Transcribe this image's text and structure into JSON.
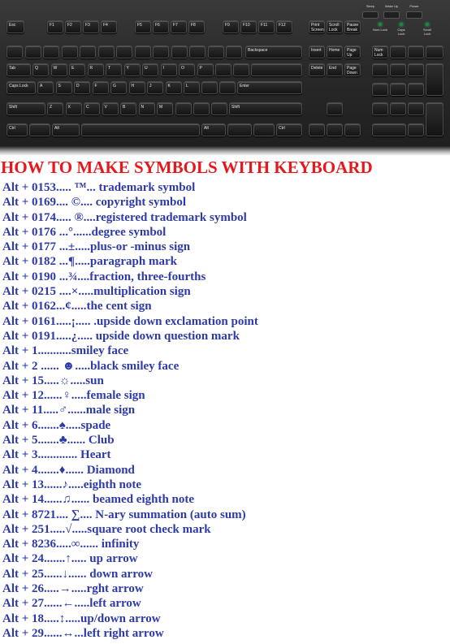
{
  "title": "HOW TO MAKE SYMBOLS WITH KEYBOARD",
  "colors": {
    "title": "#e8171b",
    "text": "#2e3aa8",
    "keyboard": "#1e1e1e"
  },
  "keyboard": {
    "function_row": [
      "Esc",
      "F1",
      "F2",
      "F3",
      "F4",
      "F5",
      "F6",
      "F7",
      "F8",
      "F9",
      "F10",
      "F11",
      "F12",
      "Print Screen",
      "Scroll Lock",
      "Pause Break"
    ],
    "power_buttons": [
      "Sleep",
      "Wake Up",
      "Power"
    ],
    "leds": [
      "Num Lock",
      "Caps Lock",
      "Scroll Lock"
    ],
    "named_keys": [
      "Tab",
      "Caps Lock",
      "Shift",
      "Ctrl",
      "Alt",
      "Enter",
      "Backspace",
      "Insert",
      "Home",
      "Page Up",
      "Delete",
      "End",
      "Page Down",
      "Num Lock",
      "Shift",
      "Alt",
      "Ctrl"
    ],
    "letter_row_1": [
      "Q",
      "W",
      "E",
      "R",
      "T",
      "Y",
      "U",
      "I",
      "O",
      "P"
    ],
    "letter_row_2": [
      "A",
      "S",
      "D",
      "F",
      "G",
      "H",
      "J",
      "K",
      "L"
    ],
    "letter_row_3": [
      "Z",
      "X",
      "C",
      "V",
      "B",
      "N",
      "M"
    ]
  },
  "items": [
    "Alt + 0153..... ™... trademark symbol",
    "Alt + 0169.... ©.... copyright symbol",
    "Alt + 0174..... ®....registered  trademark symbol",
    "Alt + 0176 ...°......degree symbol",
    "Alt + 0177 ...±.....plus-or -minus sign",
    "Alt + 0182 ...¶.....paragraph mark",
    "Alt + 0190 ...¾....fraction, three-fourths",
    "Alt + 0215 ....×.....multiplication sign",
    "Alt + 0162...¢.....the  cent sign",
    "Alt + 0161.....¡..... .upside down exclamation point",
    "Alt + 0191.....¿..... upside down question mark",
    "Alt + 1...........smiley face",
    "Alt + 2 ...... ☻.....black smiley face",
    "Alt + 15.....☼.....sun",
    "Alt + 12......♀.....female sign",
    "Alt + 11.....♂......male sign",
    "Alt + 6.......♠.....spade",
    "Alt + 5.......♣...... Club",
    "Alt + 3............. Heart",
    "Alt + 4.......♦...... Diamond",
    "Alt + 13......♪.....eighth note",
    "Alt + 14......♫...... beamed eighth note",
    "Alt + 8721.... ∑.... N-ary summation (auto sum)",
    "Alt + 251.....√.....square root check mark",
    "Alt + 8236.....∞...... infinity",
    "Alt + 24.......↑..... up arrow",
    "Alt + 25......↓...... down arrow",
    "Alt + 26.....→.....rght arrow",
    "Alt + 27......←.....left arrow",
    "Alt + 18.....↕.....up/down arrow",
    "Alt + 29......↔...left right arrow"
  ]
}
